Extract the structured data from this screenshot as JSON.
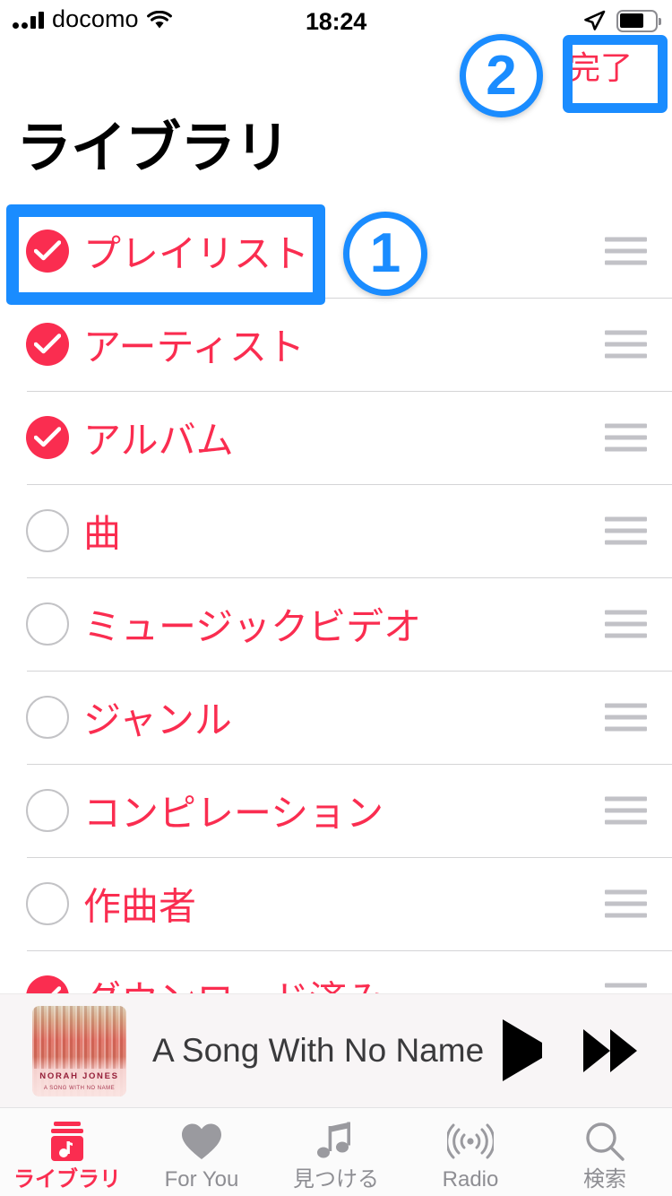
{
  "status_bar": {
    "carrier": "docomo",
    "time": "18:24",
    "signal_icon": "cellular-signal-icon",
    "wifi_icon": "wifi-icon",
    "location_icon": "location-arrow-icon",
    "battery_icon": "battery-icon",
    "battery_level_percent": 65
  },
  "header": {
    "title": "ライブラリ",
    "done_label": "完了"
  },
  "list": {
    "rows": [
      {
        "label": "プレイリスト",
        "checked": true,
        "handle_icon": "reorder-handle-icon"
      },
      {
        "label": "アーティスト",
        "checked": true,
        "handle_icon": "reorder-handle-icon"
      },
      {
        "label": "アルバム",
        "checked": true,
        "handle_icon": "reorder-handle-icon"
      },
      {
        "label": "曲",
        "checked": false,
        "handle_icon": "reorder-handle-icon"
      },
      {
        "label": "ミュージックビデオ",
        "checked": false,
        "handle_icon": "reorder-handle-icon"
      },
      {
        "label": "ジャンル",
        "checked": false,
        "handle_icon": "reorder-handle-icon"
      },
      {
        "label": "コンピレーション",
        "checked": false,
        "handle_icon": "reorder-handle-icon"
      },
      {
        "label": "作曲者",
        "checked": false,
        "handle_icon": "reorder-handle-icon"
      },
      {
        "label": "ダウンロード済み",
        "checked": true,
        "handle_icon": "reorder-handle-icon"
      }
    ]
  },
  "now_playing": {
    "track_title": "A Song With No Name",
    "artwork_artist": "NORAH JONES",
    "artwork_title": "A SONG WITH NO NAME",
    "play_icon": "play-icon",
    "next_icon": "fast-forward-icon"
  },
  "tab_bar": {
    "tabs": [
      {
        "label": "ライブラリ",
        "icon": "library-icon",
        "active": true
      },
      {
        "label": "For You",
        "icon": "heart-icon",
        "active": false
      },
      {
        "label": "見つける",
        "icon": "music-note-icon",
        "active": false
      },
      {
        "label": "Radio",
        "icon": "radio-icon",
        "active": false
      },
      {
        "label": "検索",
        "icon": "search-icon",
        "active": false
      }
    ]
  },
  "annotations": {
    "badge_one": "①",
    "badge_one_text": "1",
    "badge_two": "②",
    "badge_two_text": "2",
    "highlight_row_label": "プレイリスト",
    "highlight_done_label": "完了"
  },
  "colors": {
    "accent_pink": "#FA2D50",
    "annotation_blue": "#1A8CFF",
    "inactive_gray": "#8E8E93",
    "separator": "#D4D4D6"
  }
}
